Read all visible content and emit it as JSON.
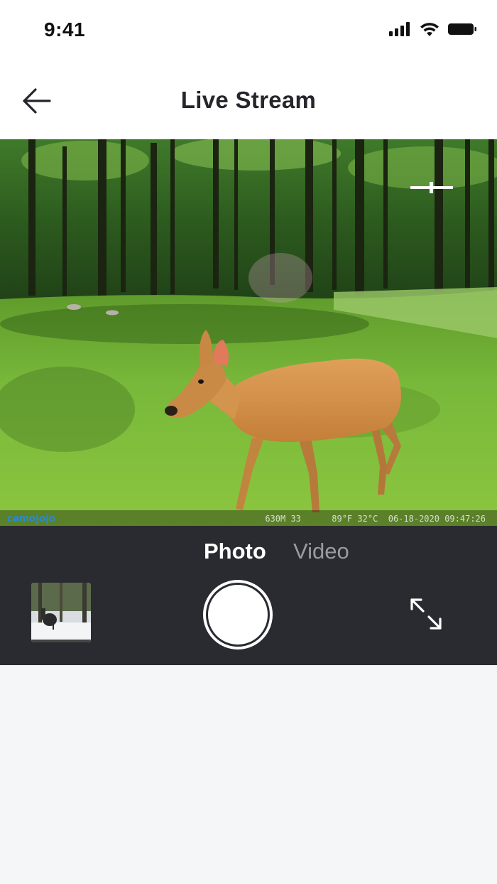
{
  "status_bar": {
    "time": "9:41",
    "icons": [
      "cellular-signal-icon",
      "wifi-icon",
      "battery-icon"
    ]
  },
  "header": {
    "back_icon": "arrow-left-icon",
    "title": "Live Stream"
  },
  "stream": {
    "brand": "camojojo",
    "info": "630M 33      89°F 32°C  06-18-2020 09:47:26",
    "zoom_icon": "zoom-slider-icon"
  },
  "controls": {
    "modes": [
      {
        "label": "Photo",
        "selected": true
      },
      {
        "label": "Video",
        "selected": false
      }
    ],
    "expand_icon": "expand-arrows-icon"
  },
  "colors": {
    "header_bg": "#ffffff",
    "control_panel_bg": "#2a2b30",
    "page_bg": "#f5f6f8",
    "brand_blue": "#2a8bd6",
    "active_tab": "#ffffff",
    "inactive_tab": "#9a9ba0"
  }
}
